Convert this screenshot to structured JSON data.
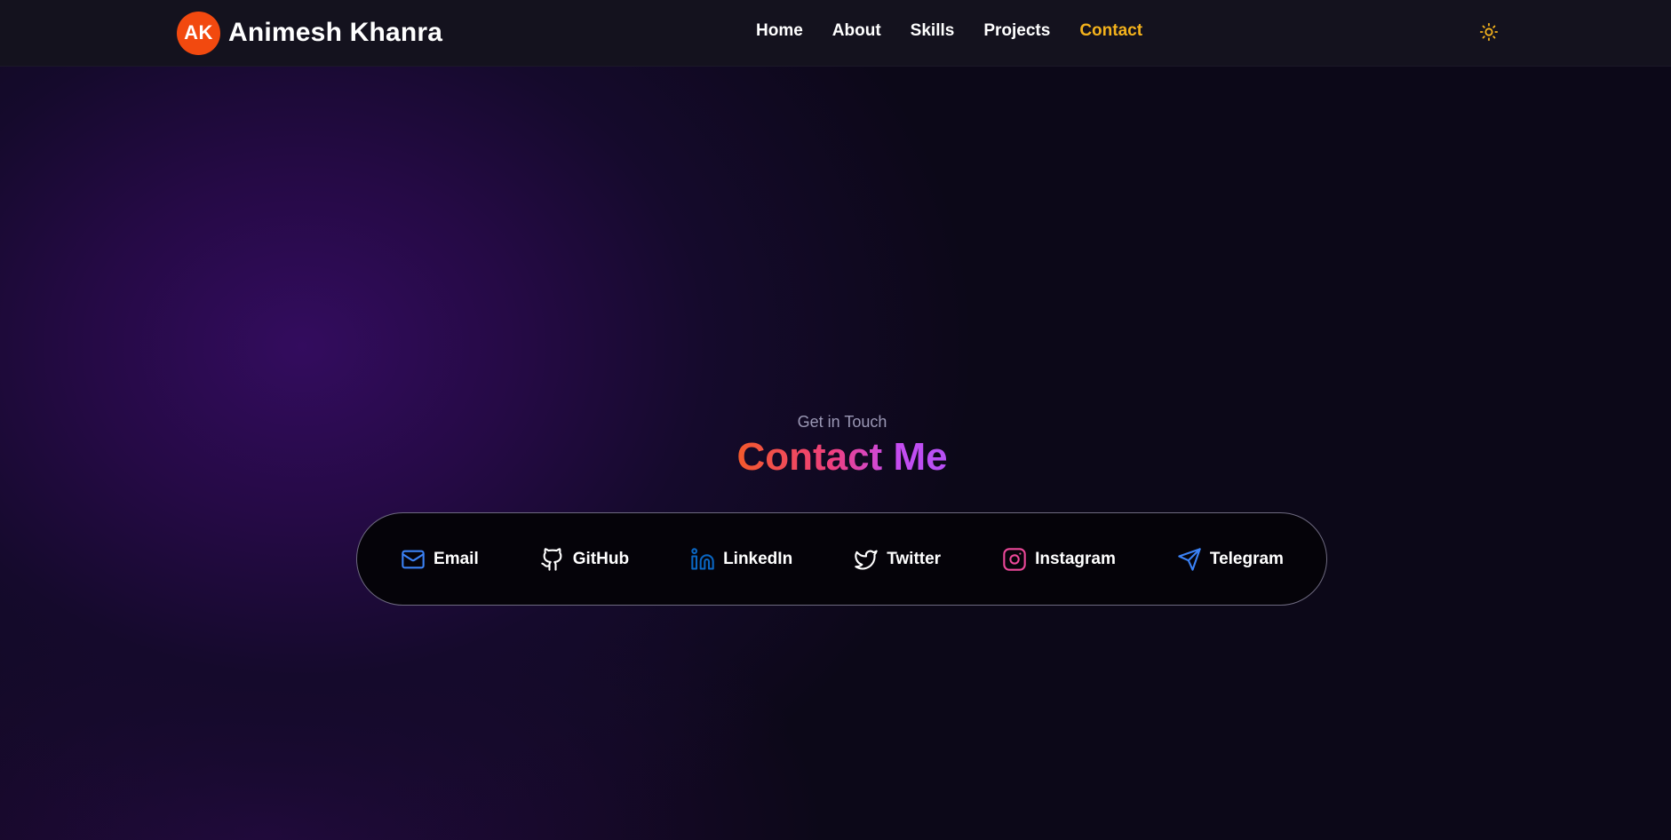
{
  "header": {
    "logo_initials": "AK",
    "brand_name": "Animesh Khanra",
    "nav": [
      {
        "label": "Home",
        "active": false
      },
      {
        "label": "About",
        "active": false
      },
      {
        "label": "Skills",
        "active": false
      },
      {
        "label": "Projects",
        "active": false
      },
      {
        "label": "Contact",
        "active": true
      }
    ],
    "theme_toggle_icon": "sun-icon"
  },
  "contact": {
    "subtitle": "Get in Touch",
    "title": "Contact Me",
    "links": [
      {
        "label": "Email",
        "icon": "mail-icon",
        "color": "#3b82f6"
      },
      {
        "label": "GitHub",
        "icon": "github-icon",
        "color": "#ffffff"
      },
      {
        "label": "LinkedIn",
        "icon": "linkedin-icon",
        "color": "#0a66c2"
      },
      {
        "label": "Twitter",
        "icon": "twitter-icon",
        "color": "#ffffff"
      },
      {
        "label": "Instagram",
        "icon": "instagram-icon",
        "color": "#ec4899"
      },
      {
        "label": "Telegram",
        "icon": "send-icon",
        "color": "#3b82f6"
      }
    ]
  },
  "colors": {
    "accent_active": "#f3b21c",
    "logo_bg": "#f2490f",
    "title_gradient": [
      "#f35a2b",
      "#ee3f7e",
      "#b651f5"
    ]
  }
}
